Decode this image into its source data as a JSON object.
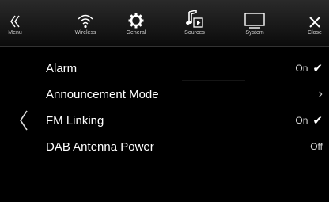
{
  "topbar": {
    "items": [
      {
        "label": "Menu",
        "icon": "double-chevron-left-icon"
      },
      {
        "label": "Wireless",
        "icon": "wireless-icon"
      },
      {
        "label": "General",
        "icon": "gear-icon"
      },
      {
        "label": "Sources",
        "icon": "music-sources-icon"
      },
      {
        "label": "System",
        "icon": "monitor-icon"
      },
      {
        "label": "Close",
        "icon": "close-icon"
      }
    ]
  },
  "list": {
    "rows": [
      {
        "label": "Alarm",
        "value": "On",
        "indicator": "check"
      },
      {
        "label": "Announcement Mode",
        "value": "",
        "indicator": "chevron-right"
      },
      {
        "label": "FM Linking",
        "value": "On",
        "indicator": "check"
      },
      {
        "label": "DAB Antenna Power",
        "value": "Off",
        "indicator": ""
      }
    ]
  },
  "colors": {
    "background": "#000000",
    "topbar": "#1e1e1e",
    "text": "#ffffff",
    "value": "#d8d8d8"
  }
}
